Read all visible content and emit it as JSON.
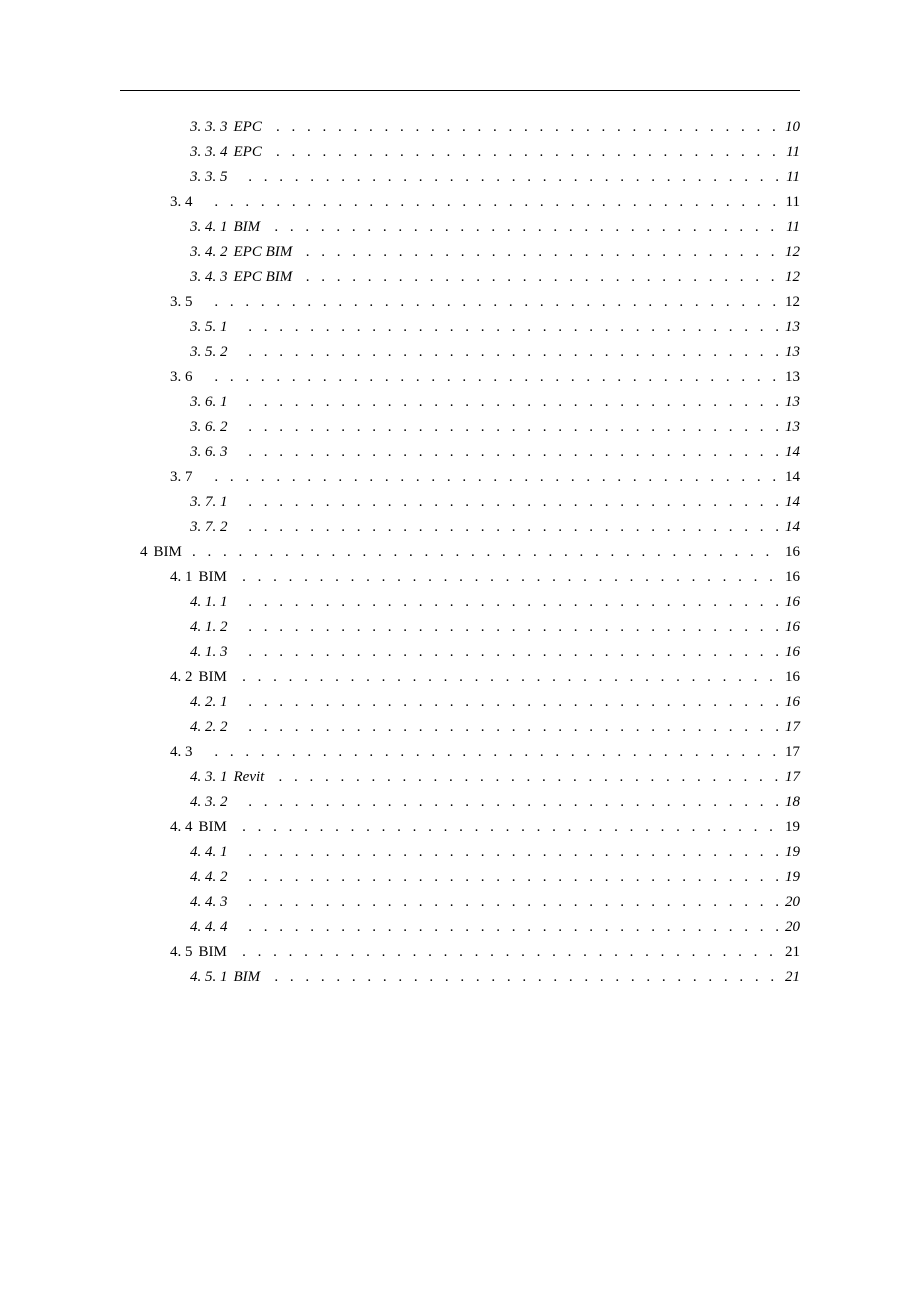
{
  "toc": [
    {
      "level": 3,
      "num": "3. 3. 3",
      "label": "EPC",
      "page": "10"
    },
    {
      "level": 3,
      "num": "3. 3. 4",
      "label": "EPC",
      "page": "11"
    },
    {
      "level": 3,
      "num": "3. 3. 5",
      "label": "",
      "page": "11"
    },
    {
      "level": 2,
      "num": "3. 4",
      "label": "",
      "page": "11"
    },
    {
      "level": 3,
      "num": "3. 4. 1",
      "label": "BIM",
      "page": "11"
    },
    {
      "level": 3,
      "num": "3. 4. 2",
      "label": "EPC              BIM",
      "page": "12"
    },
    {
      "level": 3,
      "num": "3. 4. 3",
      "label": "EPC              BIM",
      "page": "12"
    },
    {
      "level": 2,
      "num": "3. 5",
      "label": "",
      "page": "12"
    },
    {
      "level": 3,
      "num": "3. 5. 1",
      "label": "",
      "page": "13"
    },
    {
      "level": 3,
      "num": "3. 5. 2",
      "label": "",
      "page": "13"
    },
    {
      "level": 2,
      "num": "3. 6",
      "label": "",
      "page": "13"
    },
    {
      "level": 3,
      "num": "3. 6. 1",
      "label": "",
      "page": "13"
    },
    {
      "level": 3,
      "num": "3. 6. 2",
      "label": "",
      "page": "13"
    },
    {
      "level": 3,
      "num": "3. 6. 3",
      "label": "",
      "page": "14"
    },
    {
      "level": 2,
      "num": "3. 7",
      "label": "",
      "page": "14"
    },
    {
      "level": 3,
      "num": "3. 7. 1",
      "label": "",
      "page": "14"
    },
    {
      "level": 3,
      "num": "3. 7. 2",
      "label": "",
      "page": "14"
    },
    {
      "level": 1,
      "num": "4",
      "label": "BIM",
      "page": "16",
      "chapter": true
    },
    {
      "level": 2,
      "num": "4. 1",
      "label": "BIM",
      "page": "16"
    },
    {
      "level": 3,
      "num": "4. 1. 1",
      "label": "",
      "page": "16"
    },
    {
      "level": 3,
      "num": "4. 1. 2",
      "label": "",
      "page": "16"
    },
    {
      "level": 3,
      "num": "4. 1. 3",
      "label": "",
      "page": "16"
    },
    {
      "level": 2,
      "num": "4. 2",
      "label": "BIM",
      "page": "16"
    },
    {
      "level": 3,
      "num": "4. 2. 1",
      "label": "",
      "page": "16"
    },
    {
      "level": 3,
      "num": "4. 2. 2",
      "label": "",
      "page": "17"
    },
    {
      "level": 2,
      "num": "4. 3",
      "label": "",
      "page": "17"
    },
    {
      "level": 3,
      "num": "4. 3. 1",
      "label": "Revit",
      "page": "17"
    },
    {
      "level": 3,
      "num": "4. 3. 2",
      "label": "",
      "page": "18"
    },
    {
      "level": 2,
      "num": "4. 4",
      "label": "BIM",
      "page": "19"
    },
    {
      "level": 3,
      "num": "4. 4. 1",
      "label": "",
      "page": "19"
    },
    {
      "level": 3,
      "num": "4. 4. 2",
      "label": "",
      "page": "19"
    },
    {
      "level": 3,
      "num": "4. 4. 3",
      "label": "",
      "page": "20"
    },
    {
      "level": 3,
      "num": "4. 4. 4",
      "label": "",
      "page": "20"
    },
    {
      "level": 2,
      "num": "4. 5",
      "label": "BIM",
      "page": "21"
    },
    {
      "level": 3,
      "num": "4. 5. 1",
      "label": "      BIM",
      "page": "21"
    }
  ]
}
